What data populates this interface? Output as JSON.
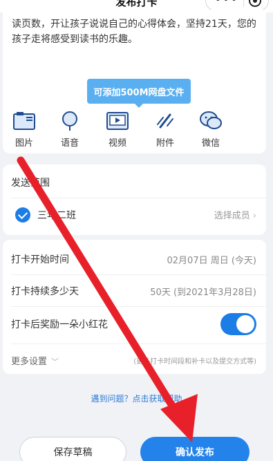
{
  "header": {
    "title": "发布打卡",
    "more_icon": "more-dots-icon",
    "close_icon": "target-icon"
  },
  "description": "读页数，开让孩子说说自己的心得体会，坚持21天，您的孩子走将感受到读书的乐趣。",
  "tooltip": "可添加500M网盘文件",
  "toolbar": [
    {
      "label": "图片",
      "icon": "image-icon"
    },
    {
      "label": "语音",
      "icon": "microphone-icon"
    },
    {
      "label": "视频",
      "icon": "video-icon"
    },
    {
      "label": "附件",
      "icon": "attachment-icon"
    },
    {
      "label": "微信",
      "icon": "wechat-icon"
    }
  ],
  "scope": {
    "title": "发送范围",
    "class_name": "三年二班",
    "select_member": "选择成员"
  },
  "settings": {
    "start_label": "打卡开始时间",
    "start_value": "02月07日 周日 (今天)",
    "duration_label": "打卡持续多少天",
    "duration_value": "50天 (到2021年3月28日)",
    "reward_label": "打卡后奖励一朵小红花",
    "reward_on": true,
    "more_label": "更多设置",
    "more_hint": "(更多打卡时间段和补卡以及提交方式等)"
  },
  "help_text": "遇到问题？点击获取帮助",
  "buttons": {
    "draft": "保存草稿",
    "publish": "确认发布"
  },
  "colors": {
    "accent": "#2383ea",
    "arrow": "#e8202a",
    "tooltip": "#5aaff0"
  }
}
